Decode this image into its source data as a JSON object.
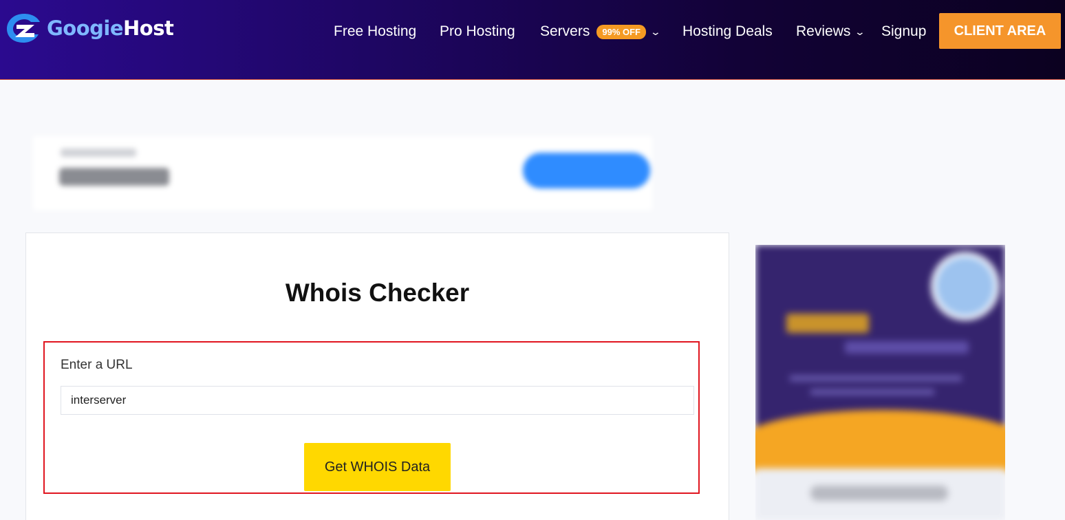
{
  "header": {
    "logo": {
      "part1": "Googie",
      "part2": "Host"
    },
    "nav": [
      {
        "label": "Free Hosting"
      },
      {
        "label": "Pro Hosting"
      },
      {
        "label": "Servers",
        "badge": "99% OFF",
        "dropdown": true
      },
      {
        "label": "Hosting Deals"
      },
      {
        "label": "Reviews",
        "dropdown": true
      },
      {
        "label": "Signup"
      }
    ],
    "cta": "CLIENT AREA"
  },
  "main": {
    "title": "Whois Checker",
    "url_label": "Enter a URL",
    "url_value": "interserver",
    "submit_label": "Get WHOIS Data"
  },
  "colors": {
    "header_gradient_start": "#2b0a8f",
    "header_gradient_end": "#0b0120",
    "cta": "#f5952b",
    "badge": "#f59a23",
    "submit_button": "#ffd800",
    "highlight_border": "#e0141e"
  },
  "icons": {
    "logo": "googiehost-logo-icon",
    "dropdown": "chevron-down-icon"
  }
}
